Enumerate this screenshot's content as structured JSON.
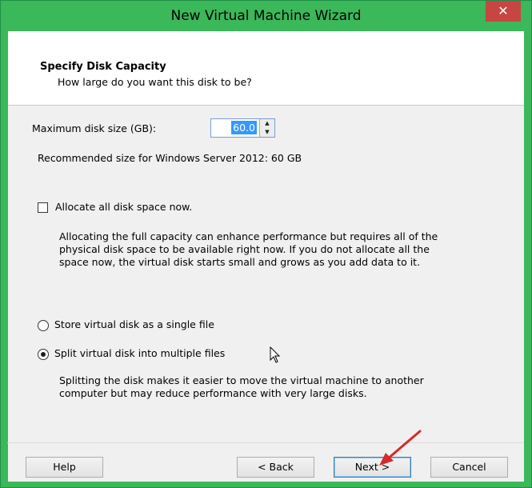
{
  "window": {
    "title": "New Virtual Machine Wizard",
    "close_glyph": "✕"
  },
  "header": {
    "title": "Specify Disk Capacity",
    "subtitle": "How large do you want this disk to be?"
  },
  "disk_size": {
    "label": "Maximum disk size (GB):",
    "value": "60.0"
  },
  "recommended": "Recommended size for Windows Server 2012: 60 GB",
  "allocate": {
    "label": "Allocate all disk space now.",
    "checked": false,
    "description_lines": [
      "Allocating the full capacity can enhance performance but requires all of the",
      "physical disk space to be available right now. If you do not allocate all the",
      "space now, the virtual disk starts small and grows as you add data to it."
    ]
  },
  "storage_options": [
    {
      "label": "Store virtual disk as a single file",
      "selected": false
    },
    {
      "label": "Split virtual disk into multiple files",
      "selected": true
    }
  ],
  "split_description_lines": [
    "Splitting the disk makes it easier to move the virtual machine to another",
    "computer but may reduce performance with very large disks."
  ],
  "buttons": {
    "help": "Help",
    "back": "< Back",
    "next": "Next >",
    "cancel": "Cancel"
  },
  "colors": {
    "title_bar": "#3bb85a",
    "close_button": "#c74642",
    "selection": "#3399ff",
    "arrow": "#d42b2b"
  }
}
